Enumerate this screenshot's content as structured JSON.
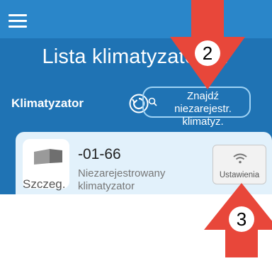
{
  "header": {
    "menu_icon": "hamburger-menu-icon"
  },
  "page": {
    "title": "Lista klimatyzatorów"
  },
  "section": {
    "label": "Klimatyzator",
    "refresh_icon": "refresh-icon",
    "find_button": {
      "label": "Znajdź niezarejestr. klimatyz.",
      "icon": "search-icon"
    }
  },
  "device": {
    "code": "-01-66",
    "status": "Niezarejestrowany klimatyzator",
    "details_label": "Szczeg.",
    "settings_label": "Ustawienia",
    "settings_icon": "wifi-icon"
  },
  "annotations": [
    {
      "number": "2",
      "color": "#e8473a"
    },
    {
      "number": "3",
      "color": "#e8473a"
    }
  ],
  "colors": {
    "app_bg": "#1f73b4",
    "topbar": "#2a86c9",
    "card_bg": "#e2f1fb",
    "arrow": "#e8473a"
  }
}
